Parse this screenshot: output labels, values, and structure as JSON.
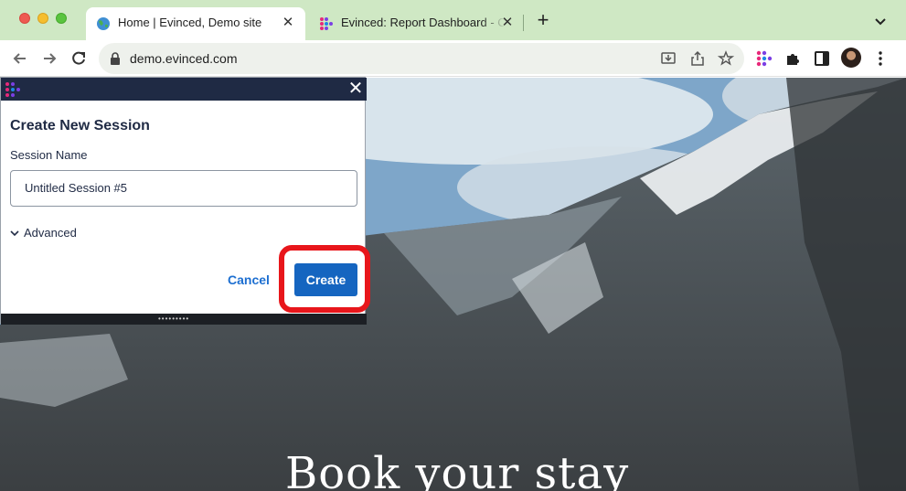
{
  "browser": {
    "tabs": [
      {
        "title": "Home | Evinced, Demo site",
        "active": true
      },
      {
        "title": "Evinced: Report Dashboard - C",
        "active": false
      }
    ],
    "url": "demo.evinced.com"
  },
  "panel": {
    "heading": "Create New Session",
    "session_name_label": "Session Name",
    "session_name_value": "Untitled Session #5",
    "advanced_label": "Advanced",
    "cancel_label": "Cancel",
    "create_label": "Create"
  },
  "page": {
    "hero_text": "Book your stay"
  },
  "colors": {
    "tab_strip": "#cfe8c4",
    "panel_header": "#1f2a44",
    "create_button": "#1565c0",
    "highlight": "#e8161b"
  }
}
